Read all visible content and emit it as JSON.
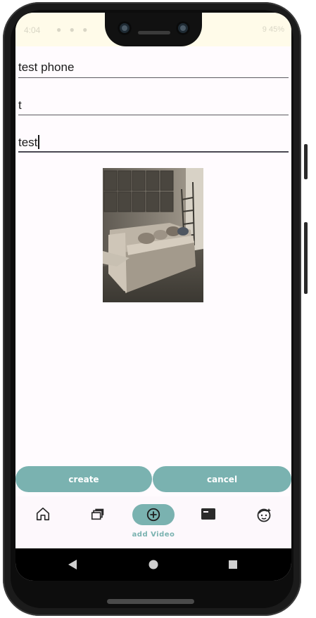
{
  "status_bar": {
    "time": "4:04",
    "right": "9 45%"
  },
  "form": {
    "name_value": "test phone",
    "field2_value": "t",
    "field3_value": "test"
  },
  "buttons": {
    "create_label": "create",
    "cancel_label": "cancel"
  },
  "nav": {
    "items": [
      {
        "icon": "home-icon",
        "label": ""
      },
      {
        "icon": "library-icon",
        "label": ""
      },
      {
        "icon": "add-circle-icon",
        "label": "add Video",
        "active": true
      },
      {
        "icon": "media-card-icon",
        "label": ""
      },
      {
        "icon": "face-icon",
        "label": ""
      }
    ]
  },
  "system_nav": {
    "back": "back-icon",
    "home": "home-circle-icon",
    "recents": "recents-icon"
  },
  "colors": {
    "accent": "#7ab2b0",
    "surface": "#fffbfe",
    "status_bar": "#fffbe9"
  }
}
